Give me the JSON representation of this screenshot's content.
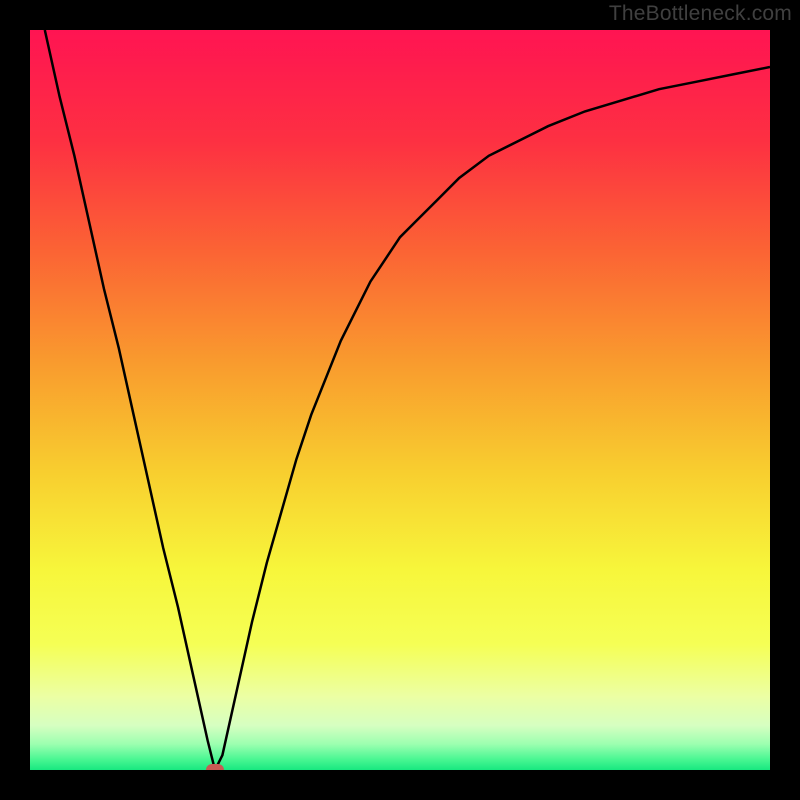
{
  "attribution": "TheBottleneck.com",
  "chart_data": {
    "type": "line",
    "title": "",
    "xlabel": "",
    "ylabel": "",
    "xlim": [
      0,
      100
    ],
    "ylim": [
      0,
      100
    ],
    "grid": false,
    "legend": false,
    "marker": {
      "x": 25,
      "y": 0,
      "color": "#c85a54"
    },
    "series": [
      {
        "name": "curve",
        "color": "#000000",
        "x": [
          2,
          4,
          6,
          8,
          10,
          12,
          14,
          16,
          18,
          20,
          22,
          24,
          25,
          26,
          28,
          30,
          32,
          34,
          36,
          38,
          40,
          42,
          44,
          46,
          48,
          50,
          52,
          55,
          58,
          62,
          66,
          70,
          75,
          80,
          85,
          90,
          95,
          100
        ],
        "y": [
          100,
          91,
          83,
          74,
          65,
          57,
          48,
          39,
          30,
          22,
          13,
          4,
          0,
          2,
          11,
          20,
          28,
          35,
          42,
          48,
          53,
          58,
          62,
          66,
          69,
          72,
          74,
          77,
          80,
          83,
          85,
          87,
          89,
          90.5,
          92,
          93,
          94,
          95
        ]
      }
    ],
    "background_gradient": {
      "stops": [
        {
          "pos": 0.0,
          "color": "#ff1452"
        },
        {
          "pos": 0.15,
          "color": "#fd3042"
        },
        {
          "pos": 0.3,
          "color": "#fb6434"
        },
        {
          "pos": 0.45,
          "color": "#f99b2e"
        },
        {
          "pos": 0.6,
          "color": "#f8cf2f"
        },
        {
          "pos": 0.73,
          "color": "#f7f63b"
        },
        {
          "pos": 0.83,
          "color": "#f5ff55"
        },
        {
          "pos": 0.9,
          "color": "#ecffa3"
        },
        {
          "pos": 0.94,
          "color": "#d6ffc1"
        },
        {
          "pos": 0.965,
          "color": "#9cffb0"
        },
        {
          "pos": 0.985,
          "color": "#4cf793"
        },
        {
          "pos": 1.0,
          "color": "#18e880"
        }
      ]
    }
  }
}
